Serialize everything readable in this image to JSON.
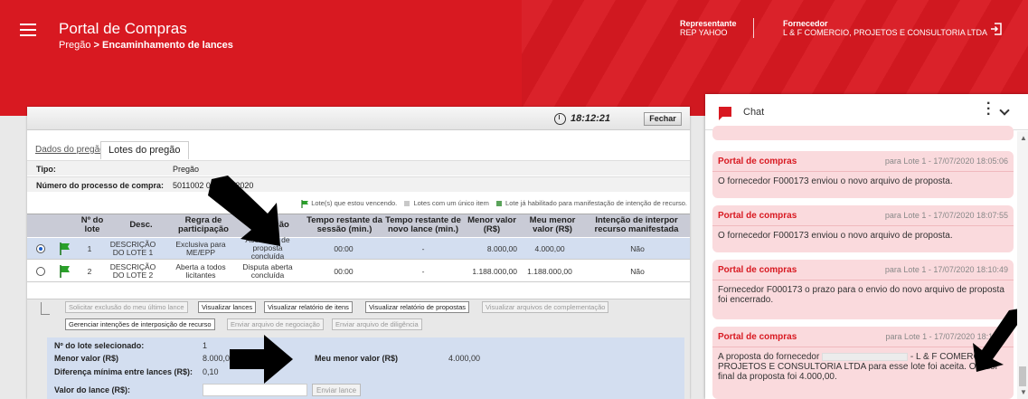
{
  "header": {
    "app_title": "Portal de Compras",
    "breadcrumb_root": "Pregão",
    "breadcrumb_sep": " > ",
    "breadcrumb_current": "Encaminhamento de lances",
    "rep_label": "Representante",
    "rep_value": "REP YAHOO",
    "forn_label": "Fornecedor",
    "forn_value": "L & F COMERCIO, PROJETOS E CONSULTORIA LTDA",
    "colors": {
      "brand": "#d81921"
    }
  },
  "toolbar": {
    "time": "18:12:21",
    "close_label": "Fechar"
  },
  "tabs": [
    {
      "label": "Dados do pregão"
    },
    {
      "label": "Lotes do pregão"
    }
  ],
  "info": {
    "tipo_label": "Tipo:",
    "tipo_value": "Pregão",
    "processo_label": "Número do processo de compra:",
    "processo_value": "5011002 000069/2020"
  },
  "legend": {
    "winning": "Lote(s) que estou vencendo.",
    "single": "Lotes com um único item",
    "enabled": "Lote já habilitado para manifestação de intenção de recurso."
  },
  "table": {
    "headers": {
      "lote": "Nº do lote",
      "desc": "Desc.",
      "regra": "Regra de participação",
      "situacao": "Situação",
      "tempo_sessao": "Tempo restante da sessão (min.)",
      "tempo_lance": "Tempo restante de novo lance (min.)",
      "menor_valor": "Menor valor (R$)",
      "meu_menor": "Meu menor valor (R$)",
      "intencao": "Intenção de interpor recurso manifestada"
    },
    "rows": [
      {
        "lote": "1",
        "desc": "DESCRIÇÃO DO LOTE 1",
        "regra": "Exclusiva para ME/EPP",
        "situacao": "Aceitação de proposta concluída",
        "tempo_sessao": "00:00",
        "tempo_lance": "-",
        "menor_valor": "8.000,00",
        "meu_menor": "4.000,00",
        "intencao": "Não"
      },
      {
        "lote": "2",
        "desc": "DESCRIÇÃO DO LOTE 2",
        "regra": "Aberta a todos licitantes",
        "situacao": "Disputa aberta concluída",
        "tempo_sessao": "00:00",
        "tempo_lance": "-",
        "menor_valor": "1.188.000,00",
        "meu_menor": "1.188.000,00",
        "intencao": "Não"
      }
    ]
  },
  "actions": {
    "solicitar": "Solicitar exclusão do meu último lance",
    "visualizar_lances": "Visualizar lances",
    "relatorio_itens": "Visualizar relatório de itens",
    "relatorio_propostas": "Visualizar relatório de propostas",
    "arquivos_compl": "Visualizar arquivos de complementação",
    "gerenciar": "Gerenciar intenções de interposição de recurso",
    "negociacao": "Enviar arquivo de negociação",
    "diligencia": "Enviar arquivo de diligência"
  },
  "detail": {
    "lote_label": "Nº do lote selecionado:",
    "lote_value": "1",
    "menor_label": "Menor valor (R$)",
    "menor_value": "8.000,00",
    "meu_label": "Meu menor valor (R$)",
    "meu_value": "4.000,00",
    "diff_label": "Diferença mínima entre lances (R$):",
    "diff_value": "0,10",
    "valor_label": "Valor do lance (R$):",
    "enviar_label": "Enviar lance"
  },
  "chat": {
    "title": "Chat",
    "messages": [
      {
        "from": "Portal de compras",
        "meta": "para Lote 1 - 17/07/2020 18:05:06",
        "text": "O fornecedor F000173 enviou o novo arquivo de proposta."
      },
      {
        "from": "Portal de compras",
        "meta": "para Lote 1 - 17/07/2020 18:07:55",
        "text": "O fornecedor F000173 enviou o novo arquivo de proposta."
      },
      {
        "from": "Portal de compras",
        "meta": "para Lote 1 - 17/07/2020 18:10:49",
        "text": "Fornecedor F000173 o prazo para o envio do novo arquivo de proposta foi encerrado."
      },
      {
        "from": "Portal de compras",
        "meta": "para Lote 1 - 17/07/2020 18:11:49",
        "text_a": "A proposta do fornecedor",
        "text_b": "- L & F COMERCIO, PROJETOS E CONSULTORIA LTDA para esse lote foi aceita. O valor final da proposta foi 4.000,00."
      }
    ]
  }
}
